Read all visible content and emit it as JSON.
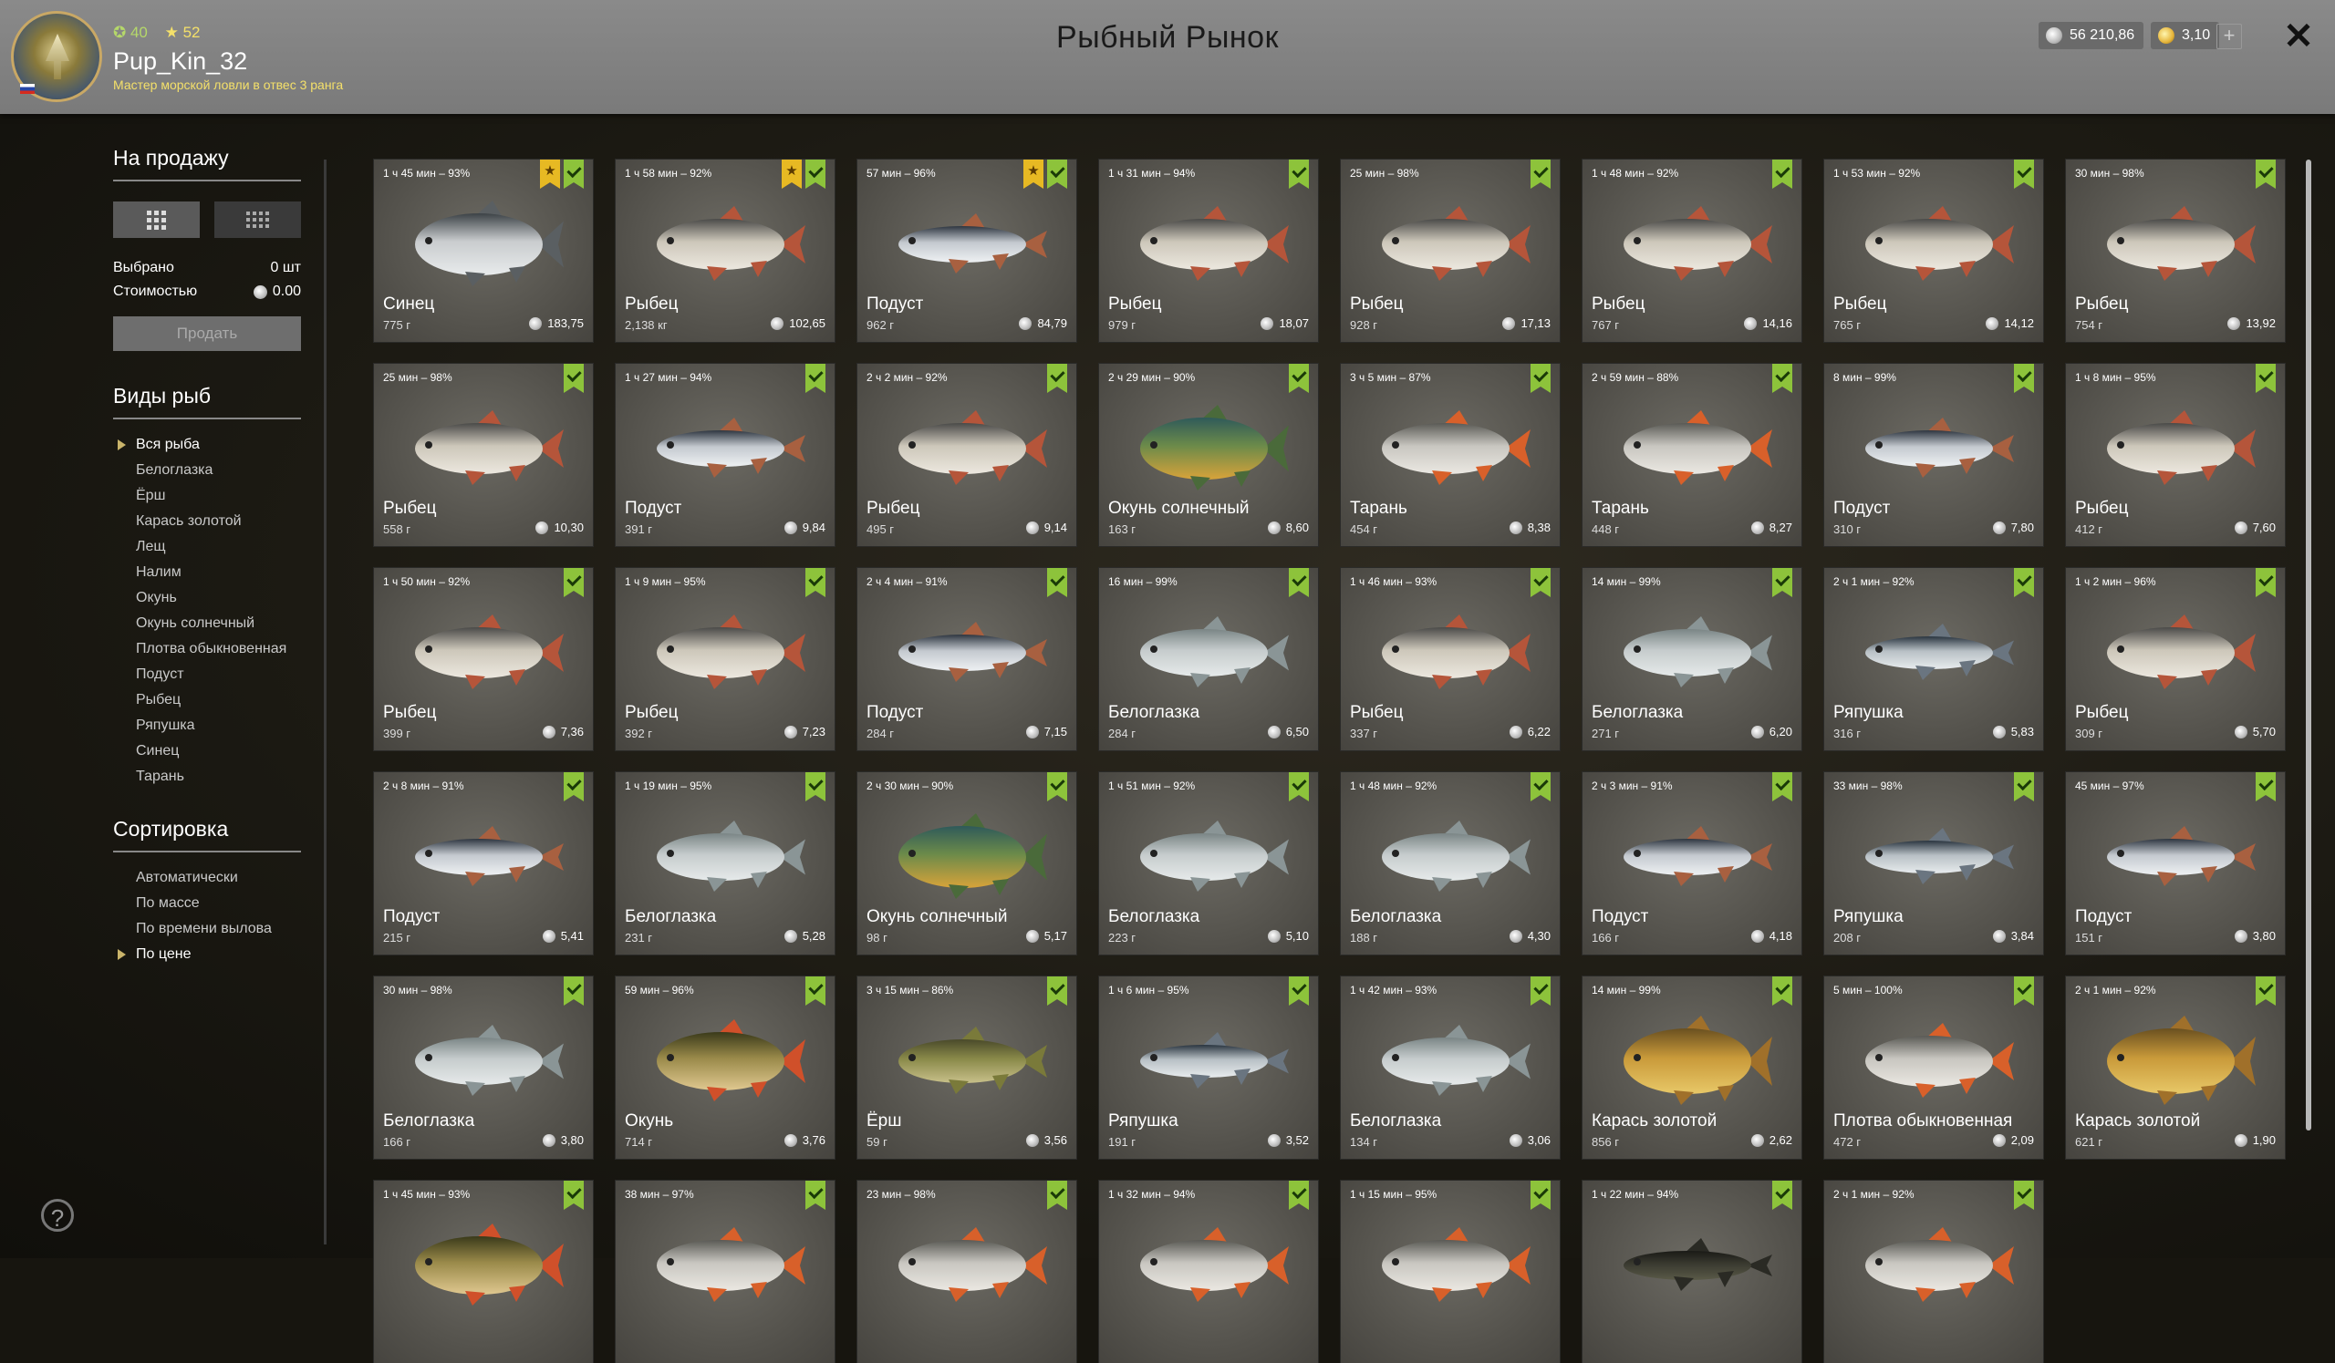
{
  "header": {
    "title": "Рыбный Рынок",
    "level": "40",
    "stars": "52",
    "username": "Pup_Kin_32",
    "rank": "Мастер морской ловли в отвес 3 ранга",
    "silver": "56 210,86",
    "gold": "3,10",
    "plus": "+",
    "close": "✕"
  },
  "sidebar": {
    "sale_heading": "На продажу",
    "selected_label": "Выбрано",
    "selected_value": "0 шт",
    "cost_label": "Стоимостью",
    "cost_value": "0.00",
    "sell_button": "Продать",
    "species_heading": "Виды рыб",
    "species": [
      "Вся рыба",
      "Белоглазка",
      "Ёрш",
      "Карась золотой",
      "Лещ",
      "Налим",
      "Окунь",
      "Окунь солнечный",
      "Плотва обыкновенная",
      "Подуст",
      "Рыбец",
      "Ряпушка",
      "Синец",
      "Тарань"
    ],
    "species_active": 0,
    "sort_heading": "Сортировка",
    "sort": [
      "Автоматически",
      "По массе",
      "По времени вылова",
      "По цене"
    ],
    "sort_active": 3,
    "help": "?"
  },
  "colors": {
    "check": "#8dc33b",
    "star": "#e7b923",
    "gold": "#f4e06a"
  },
  "fish": [
    {
      "time": "1 ч 45 мин – 93%",
      "name": "Синец",
      "weight": "775 г",
      "price": "183,75",
      "star": true,
      "kind": "bream"
    },
    {
      "time": "1 ч 58 мин – 92%",
      "name": "Рыбец",
      "weight": "2,138 кг",
      "price": "102,65",
      "star": true,
      "kind": "vimba"
    },
    {
      "time": "57 мин – 96%",
      "name": "Подуст",
      "weight": "962 г",
      "price": "84,79",
      "star": true,
      "kind": "nase"
    },
    {
      "time": "1 ч 31 мин – 94%",
      "name": "Рыбец",
      "weight": "979 г",
      "price": "18,07",
      "star": false,
      "kind": "vimba"
    },
    {
      "time": "25 мин – 98%",
      "name": "Рыбец",
      "weight": "928 г",
      "price": "17,13",
      "star": false,
      "kind": "vimba"
    },
    {
      "time": "1 ч 48 мин – 92%",
      "name": "Рыбец",
      "weight": "767 г",
      "price": "14,16",
      "star": false,
      "kind": "vimba"
    },
    {
      "time": "1 ч 53 мин – 92%",
      "name": "Рыбец",
      "weight": "765 г",
      "price": "14,12",
      "star": false,
      "kind": "vimba"
    },
    {
      "time": "30 мин – 98%",
      "name": "Рыбец",
      "weight": "754 г",
      "price": "13,92",
      "star": false,
      "kind": "vimba"
    },
    {
      "time": "25 мин – 98%",
      "name": "Рыбец",
      "weight": "558 г",
      "price": "10,30",
      "star": false,
      "kind": "vimba"
    },
    {
      "time": "1 ч 27 мин – 94%",
      "name": "Подуст",
      "weight": "391 г",
      "price": "9,84",
      "star": false,
      "kind": "nase"
    },
    {
      "time": "2 ч 2 мин – 92%",
      "name": "Рыбец",
      "weight": "495 г",
      "price": "9,14",
      "star": false,
      "kind": "vimba"
    },
    {
      "time": "2 ч 29 мин – 90%",
      "name": "Окунь солнечный",
      "weight": "163 г",
      "price": "8,60",
      "star": false,
      "kind": "sunfish"
    },
    {
      "time": "3 ч 5 мин – 87%",
      "name": "Тарань",
      "weight": "454 г",
      "price": "8,38",
      "star": false,
      "kind": "roach"
    },
    {
      "time": "2 ч 59 мин – 88%",
      "name": "Тарань",
      "weight": "448 г",
      "price": "8,27",
      "star": false,
      "kind": "roach"
    },
    {
      "time": "8 мин – 99%",
      "name": "Подуст",
      "weight": "310 г",
      "price": "7,80",
      "star": false,
      "kind": "nase"
    },
    {
      "time": "1 ч 8 мин – 95%",
      "name": "Рыбец",
      "weight": "412 г",
      "price": "7,60",
      "star": false,
      "kind": "vimba"
    },
    {
      "time": "1 ч 50 мин – 92%",
      "name": "Рыбец",
      "weight": "399 г",
      "price": "7,36",
      "star": false,
      "kind": "vimba"
    },
    {
      "time": "1 ч 9 мин – 95%",
      "name": "Рыбец",
      "weight": "392 г",
      "price": "7,23",
      "star": false,
      "kind": "vimba"
    },
    {
      "time": "2 ч 4 мин – 91%",
      "name": "Подуст",
      "weight": "284 г",
      "price": "7,15",
      "star": false,
      "kind": "nase"
    },
    {
      "time": "16 мин – 99%",
      "name": "Белоглазка",
      "weight": "284 г",
      "price": "6,50",
      "star": false,
      "kind": "whiteeye"
    },
    {
      "time": "1 ч 46 мин – 93%",
      "name": "Рыбец",
      "weight": "337 г",
      "price": "6,22",
      "star": false,
      "kind": "vimba"
    },
    {
      "time": "14 мин – 99%",
      "name": "Белоглазка",
      "weight": "271 г",
      "price": "6,20",
      "star": false,
      "kind": "whiteeye"
    },
    {
      "time": "2 ч 1 мин – 92%",
      "name": "Ряпушка",
      "weight": "316 г",
      "price": "5,83",
      "star": false,
      "kind": "vendace"
    },
    {
      "time": "1 ч 2 мин – 96%",
      "name": "Рыбец",
      "weight": "309 г",
      "price": "5,70",
      "star": false,
      "kind": "vimba"
    },
    {
      "time": "2 ч 8 мин – 91%",
      "name": "Подуст",
      "weight": "215 г",
      "price": "5,41",
      "star": false,
      "kind": "nase"
    },
    {
      "time": "1 ч 19 мин – 95%",
      "name": "Белоглазка",
      "weight": "231 г",
      "price": "5,28",
      "star": false,
      "kind": "whiteeye"
    },
    {
      "time": "2 ч 30 мин – 90%",
      "name": "Окунь солнечный",
      "weight": "98 г",
      "price": "5,17",
      "star": false,
      "kind": "sunfish"
    },
    {
      "time": "1 ч 51 мин – 92%",
      "name": "Белоглазка",
      "weight": "223 г",
      "price": "5,10",
      "star": false,
      "kind": "whiteeye"
    },
    {
      "time": "1 ч 48 мин – 92%",
      "name": "Белоглазка",
      "weight": "188 г",
      "price": "4,30",
      "star": false,
      "kind": "whiteeye"
    },
    {
      "time": "2 ч 3 мин – 91%",
      "name": "Подуст",
      "weight": "166 г",
      "price": "4,18",
      "star": false,
      "kind": "nase"
    },
    {
      "time": "33 мин – 98%",
      "name": "Ряпушка",
      "weight": "208 г",
      "price": "3,84",
      "star": false,
      "kind": "vendace"
    },
    {
      "time": "45 мин – 97%",
      "name": "Подуст",
      "weight": "151 г",
      "price": "3,80",
      "star": false,
      "kind": "nase"
    },
    {
      "time": "30 мин – 98%",
      "name": "Белоглазка",
      "weight": "166 г",
      "price": "3,80",
      "star": false,
      "kind": "whiteeye"
    },
    {
      "time": "59 мин – 96%",
      "name": "Окунь",
      "weight": "714 г",
      "price": "3,76",
      "star": false,
      "kind": "perch"
    },
    {
      "time": "3 ч 15 мин – 86%",
      "name": "Ёрш",
      "weight": "59 г",
      "price": "3,56",
      "star": false,
      "kind": "ruffe"
    },
    {
      "time": "1 ч 6 мин – 95%",
      "name": "Ряпушка",
      "weight": "191 г",
      "price": "3,52",
      "star": false,
      "kind": "vendace"
    },
    {
      "time": "1 ч 42 мин – 93%",
      "name": "Белоглазка",
      "weight": "134 г",
      "price": "3,06",
      "star": false,
      "kind": "whiteeye"
    },
    {
      "time": "14 мин – 99%",
      "name": "Карась золотой",
      "weight": "856 г",
      "price": "2,62",
      "star": false,
      "kind": "crucian"
    },
    {
      "time": "5 мин – 100%",
      "name": "Плотва обыкновенная",
      "weight": "472 г",
      "price": "2,09",
      "star": false,
      "kind": "roach"
    },
    {
      "time": "2 ч 1 мин – 92%",
      "name": "Карась золотой",
      "weight": "621 г",
      "price": "1,90",
      "star": false,
      "kind": "crucian"
    },
    {
      "time": "1 ч 45 мин – 93%",
      "name": "",
      "weight": "",
      "price": "",
      "star": false,
      "kind": "perch"
    },
    {
      "time": "38 мин – 97%",
      "name": "",
      "weight": "",
      "price": "",
      "star": false,
      "kind": "roach"
    },
    {
      "time": "23 мин – 98%",
      "name": "",
      "weight": "",
      "price": "",
      "star": false,
      "kind": "roach"
    },
    {
      "time": "1 ч 32 мин – 94%",
      "name": "",
      "weight": "",
      "price": "",
      "star": false,
      "kind": "roach"
    },
    {
      "time": "1 ч 15 мин – 95%",
      "name": "",
      "weight": "",
      "price": "",
      "star": false,
      "kind": "roach"
    },
    {
      "time": "1 ч 22 мин – 94%",
      "name": "",
      "weight": "",
      "price": "",
      "star": false,
      "kind": "burbot"
    },
    {
      "time": "2 ч 1 мин – 92%",
      "name": "",
      "weight": "",
      "price": "",
      "star": false,
      "kind": "roach"
    }
  ]
}
